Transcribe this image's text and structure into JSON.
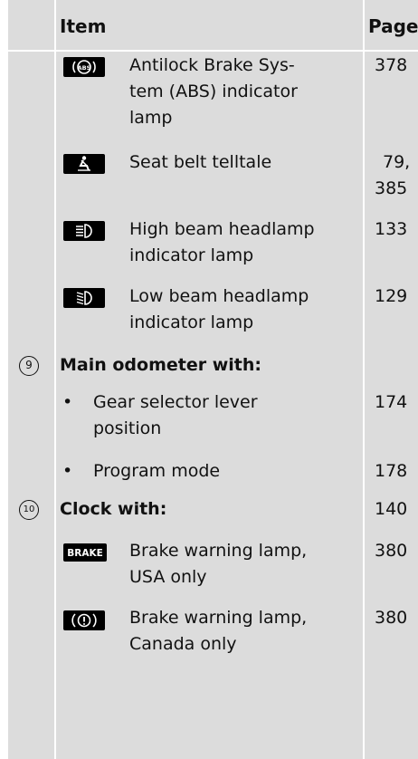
{
  "header": {
    "item": "Item",
    "page": "Page"
  },
  "rows": [
    {
      "icon": "abs-indicator-icon",
      "lines": [
        "Antilock Brake Sys-",
        "tem (ABS) indicator",
        "lamp"
      ],
      "page": "378"
    },
    {
      "icon": "seat-belt-icon",
      "lines": [
        "Seat belt telltale"
      ],
      "page_lines": [
        "79,",
        "385"
      ]
    },
    {
      "icon": "high-beam-icon",
      "lines": [
        "High beam headlamp",
        "indicator lamp"
      ],
      "page": "133"
    },
    {
      "icon": "low-beam-icon",
      "lines": [
        "Low beam headlamp",
        "indicator lamp"
      ],
      "page": "129"
    }
  ],
  "section9": {
    "marker": "9",
    "title": "Main odometer with:",
    "bullets": [
      {
        "lines": [
          "Gear selector lever",
          "position"
        ],
        "page": "174"
      },
      {
        "lines": [
          "Program mode"
        ],
        "page": "178"
      }
    ]
  },
  "section10": {
    "marker": "10",
    "title": "Clock with:",
    "page": "140",
    "rows": [
      {
        "icon": "brake-text-icon",
        "icon_text": "BRAKE",
        "lines": [
          "Brake warning lamp,",
          "USA only"
        ],
        "page": "380"
      },
      {
        "icon": "brake-warning-icon",
        "lines": [
          "Brake warning lamp,",
          "Canada only"
        ],
        "page": "380"
      }
    ]
  },
  "bullet_char": "•"
}
